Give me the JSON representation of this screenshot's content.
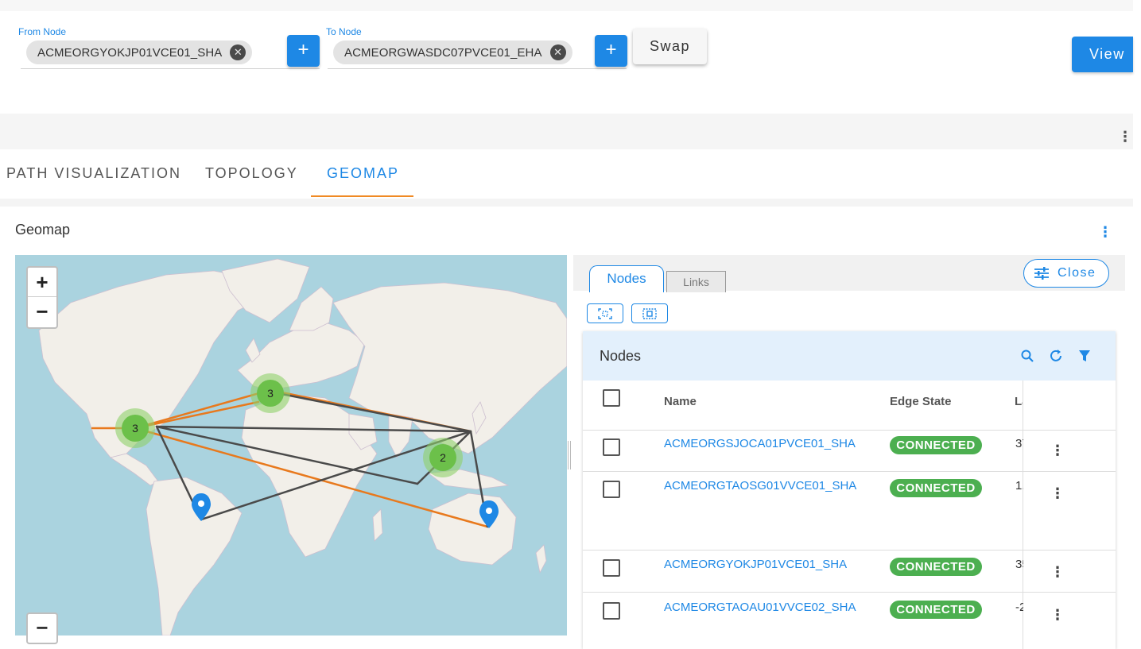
{
  "query": {
    "from_label": "From Node",
    "from_value": "ACMEORGYOKJP01VCE01_SHA",
    "to_label": "To Node",
    "to_value": "ACMEORGWASDC07PVCE01_EHA",
    "add_symbol": "+",
    "remove_symbol": "✕",
    "swap_label": "Swap",
    "view_label": "View"
  },
  "tabs": [
    {
      "label": "PATH VISUALIZATION"
    },
    {
      "label": "TOPOLOGY"
    },
    {
      "label": "GEOMAP",
      "active": true
    }
  ],
  "geomap": {
    "title": "Geomap",
    "zoom_in": "+",
    "zoom_out": "−",
    "clusters": [
      {
        "count": "3",
        "region": "north-america"
      },
      {
        "count": "3",
        "region": "europe"
      },
      {
        "count": "2",
        "region": "southeast-asia"
      }
    ],
    "colors": {
      "orange_link": "#e8791d",
      "dark_link": "#4a4a4a",
      "cluster": "#6cc04a",
      "marker": "#1e88e5"
    }
  },
  "panel": {
    "tab_nodes": "Nodes",
    "tab_links": "Links",
    "close_label": "Close",
    "grid_title": "Nodes",
    "columns": {
      "name": "Name",
      "edge_state": "Edge State",
      "third": "La"
    },
    "rows": [
      {
        "name": "ACMEORGSJOCA01PVCE01_SHA",
        "state": "CONNECTED",
        "lat": "37"
      },
      {
        "name": "ACMEORGTAOSG01VVCE01_SHA",
        "state": "CONNECTED",
        "lat": "1."
      },
      {
        "name": "ACMEORGYOKJP01VCE01_SHA",
        "state": "CONNECTED",
        "lat": "35"
      },
      {
        "name": "ACMEORGTAOAU01VVCE02_SHA",
        "state": "CONNECTED",
        "lat": "-2"
      }
    ],
    "colors": {
      "accent": "#1e88e5",
      "connected": "#4caf50",
      "header_bg": "#e3f0fc"
    }
  }
}
